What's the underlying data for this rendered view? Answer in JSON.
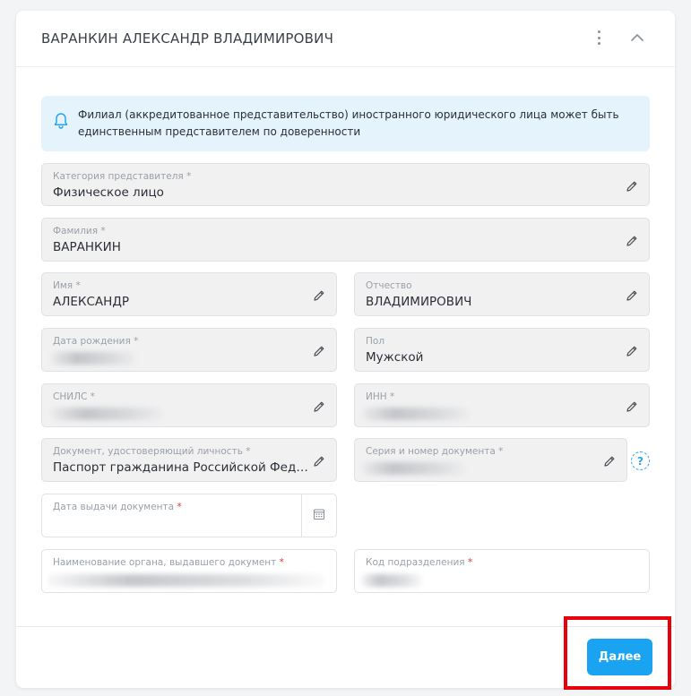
{
  "header": {
    "title": "ВАРАНКИН АЛЕКСАНДР ВЛАДИМИРОВИЧ"
  },
  "notice": {
    "text": "Филиал (аккредитованное представительство) иностранного юридического лица может быть единственным представителем по доверенности"
  },
  "fields": {
    "category": {
      "label": "Категория представителя",
      "req": "*",
      "value": "Физическое лицо"
    },
    "surname": {
      "label": "Фамилия",
      "req": "*",
      "value": "ВАРАНКИН"
    },
    "name": {
      "label": "Имя",
      "req": "*",
      "value": "АЛЕКСАНДР"
    },
    "patronymic": {
      "label": "Отчество",
      "value": "ВЛАДИМИРОВИЧ"
    },
    "birth_date": {
      "label": "Дата рождения",
      "req": "*"
    },
    "gender": {
      "label": "Пол",
      "value": "Мужской"
    },
    "snils": {
      "label": "СНИЛС",
      "req": "*"
    },
    "inn": {
      "label": "ИНН",
      "req": "*"
    },
    "document": {
      "label": "Документ, удостоверяющий личность",
      "req": "*",
      "value": "Паспорт гражданина Российской Федерации"
    },
    "doc_number": {
      "label": "Серия и номер документа",
      "req": "*"
    },
    "issue_date": {
      "label": "Дата выдачи документа",
      "req": "*"
    },
    "issuer": {
      "label": "Наименование органа, выдавшего документ",
      "req": "*"
    },
    "dept_code": {
      "label": "Код подразделения",
      "req": "*"
    }
  },
  "help": {
    "symbol": "?"
  },
  "footer": {
    "next_label": "Далее"
  },
  "colors": {
    "accent": "#1aa3f0",
    "notice_bg": "#e4f3fc",
    "required": "#e2363f",
    "highlight": "#e8000d"
  }
}
